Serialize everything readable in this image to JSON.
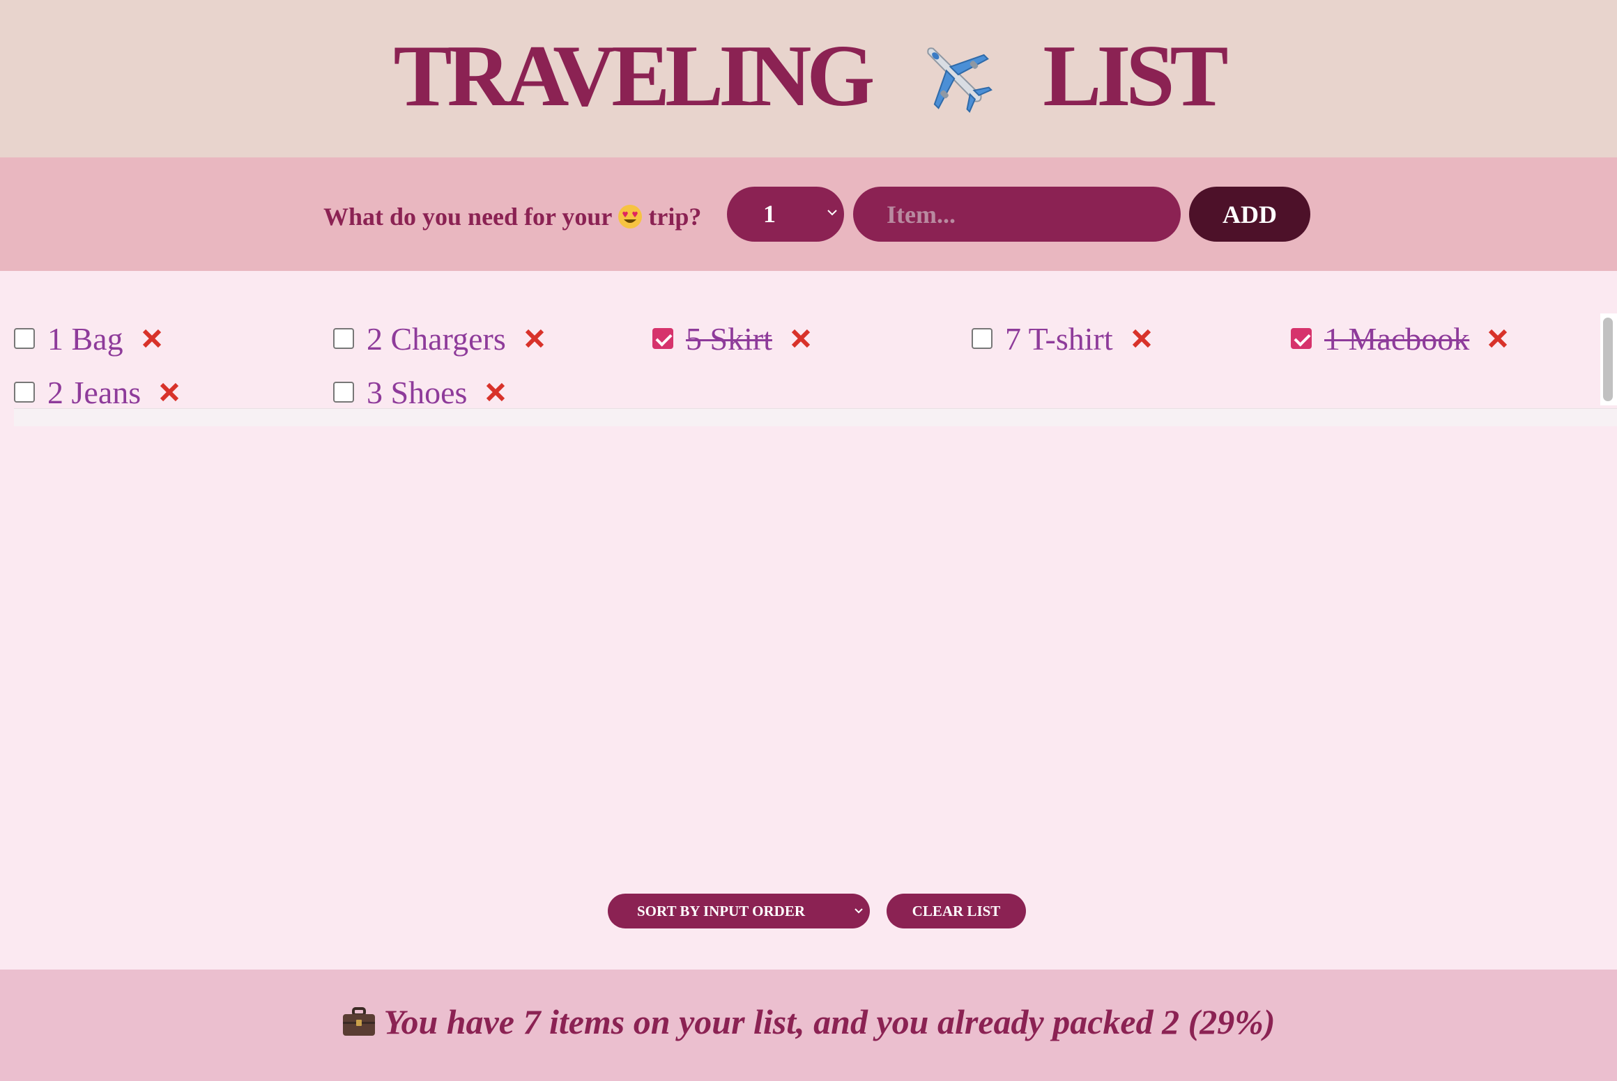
{
  "header": {
    "title_left": "TRAVELING",
    "title_icon": "airplane-icon",
    "title_right": "LIST"
  },
  "form": {
    "question_before": "What do you need for your",
    "question_icon": "heart-eyes-smiley-icon",
    "question_after": "trip?",
    "quantity_value": "1",
    "item_placeholder": "Item...",
    "add_label": "ADD"
  },
  "items": [
    {
      "label": "1 Bag",
      "packed": false
    },
    {
      "label": "2 Chargers",
      "packed": false
    },
    {
      "label": "5 Skirt",
      "packed": true
    },
    {
      "label": "7 T-shirt",
      "packed": false
    },
    {
      "label": "1 Macbook",
      "packed": true
    },
    {
      "label": "2 Jeans",
      "packed": false
    },
    {
      "label": "3 Shoes",
      "packed": false
    }
  ],
  "actions": {
    "sort_value": "SORT BY INPUT ORDER",
    "clear_label": "CLEAR LIST"
  },
  "footer": {
    "icon": "briefcase-icon",
    "stats_text": "You have 7 items on your list, and you already packed 2 (29%)"
  },
  "colors": {
    "primary": "#8b2253",
    "dark_button": "#4d1129",
    "item_text": "#8e3b9a",
    "delete_x": "#d8322a",
    "header_bg": "#e8d4cd",
    "form_bg": "#e9b7c0",
    "list_bg": "#fbe9f1",
    "footer_bg": "#ebbfcf"
  }
}
